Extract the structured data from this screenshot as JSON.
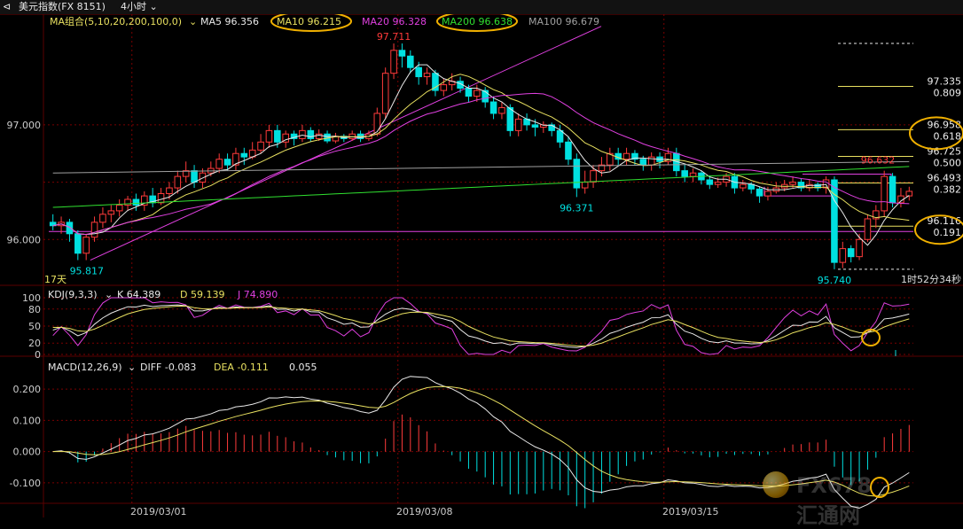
{
  "header": {
    "back_icon": "back-icon",
    "title": "美元指数(FX 8151)",
    "period": "4小时"
  },
  "ma_legend": [
    {
      "text": "MA组合(5,10,20,200,100,0)",
      "color": "#e8e060"
    },
    {
      "text": "MA5 96.356",
      "color": "#e8e8e8"
    },
    {
      "text": "MA10 96.215",
      "color": "#e8e060"
    },
    {
      "text": "MA20 96.328",
      "color": "#e040e0"
    },
    {
      "text": "MA200 96.638",
      "color": "#30e030"
    },
    {
      "text": "MA100 96.679",
      "color": "#a0a0a0"
    }
  ],
  "kdj_legend": [
    {
      "text": "KDJ(9,3,3)",
      "color": "#e8e8e8"
    },
    {
      "text": "K 64.389",
      "color": "#e8e8e8"
    },
    {
      "text": "D 59.139",
      "color": "#e8e060"
    },
    {
      "text": "J 74.890",
      "color": "#e040e0"
    }
  ],
  "macd_legend": [
    {
      "text": "MACD(12,26,9)",
      "color": "#e8e8e8"
    },
    {
      "text": "DIFF -0.083",
      "color": "#e8e8e8"
    },
    {
      "text": "DEA -0.111",
      "color": "#e8e060"
    },
    {
      "text": "0.055",
      "color": "#e8e8e8"
    }
  ],
  "price_axis": [
    "97.000",
    "96.000"
  ],
  "kdj_axis": [
    "100",
    "80",
    "50",
    "20",
    "0"
  ],
  "macd_axis": [
    "0.200",
    "0.100",
    "0.000",
    "-0.100"
  ],
  "date_labels": [
    "2019/03/01",
    "2019/03/08",
    "2019/03/15"
  ],
  "annotations": {
    "high": "97.711",
    "low1": "95.817",
    "mid_low": "96.371",
    "low2": "95.740",
    "fib_top": "96.632",
    "interval": "17天",
    "countdown": "1时52分34秒"
  },
  "fib_levels": [
    {
      "price": "97.335",
      "ratio": "0.809"
    },
    {
      "price": "96.958",
      "ratio": "0.618"
    },
    {
      "price": "96.725",
      "ratio": "0.500"
    },
    {
      "price": "96.493",
      "ratio": "0.382"
    },
    {
      "price": "96.116",
      "ratio": "0.191"
    }
  ],
  "watermark": "FX678汇通网",
  "colors": {
    "up": "#ff3b3b",
    "down": "#00e0e0",
    "ma5": "#e8e8e8",
    "ma10": "#e8e060",
    "ma20": "#e040e0",
    "ma200": "#30e030",
    "ma100": "#a0a0a0",
    "grid": "#7a0000",
    "highlight": "#f0b000"
  },
  "chart_data": {
    "type": "candlestick",
    "candles": [
      [
        96.15,
        96.12,
        96.22,
        96.08
      ],
      [
        96.12,
        96.15,
        96.2,
        96.05
      ],
      [
        96.15,
        96.05,
        96.18,
        95.98
      ],
      [
        96.05,
        95.88,
        96.08,
        95.82
      ],
      [
        95.88,
        96.02,
        96.05,
        95.82
      ],
      [
        96.02,
        96.15,
        96.2,
        95.98
      ],
      [
        96.15,
        96.22,
        96.28,
        96.1
      ],
      [
        96.22,
        96.25,
        96.3,
        96.15
      ],
      [
        96.25,
        96.3,
        96.35,
        96.2
      ],
      [
        96.3,
        96.35,
        96.38,
        96.25
      ],
      [
        96.35,
        96.3,
        96.4,
        96.25
      ],
      [
        96.3,
        96.38,
        96.42,
        96.25
      ],
      [
        96.38,
        96.32,
        96.45,
        96.28
      ],
      [
        96.32,
        96.4,
        96.45,
        96.3
      ],
      [
        96.4,
        96.45,
        96.5,
        96.35
      ],
      [
        96.45,
        96.55,
        96.6,
        96.4
      ],
      [
        96.55,
        96.6,
        96.68,
        96.5
      ],
      [
        96.6,
        96.5,
        96.65,
        96.45
      ],
      [
        96.5,
        96.58,
        96.62,
        96.45
      ],
      [
        96.58,
        96.62,
        96.68,
        96.55
      ],
      [
        96.62,
        96.7,
        96.75,
        96.58
      ],
      [
        96.7,
        96.65,
        96.75,
        96.6
      ],
      [
        96.65,
        96.75,
        96.8,
        96.6
      ],
      [
        96.75,
        96.72,
        96.8,
        96.65
      ],
      [
        96.72,
        96.78,
        96.85,
        96.7
      ],
      [
        96.78,
        96.85,
        96.92,
        96.75
      ],
      [
        96.85,
        96.95,
        97,
        96.8
      ],
      [
        96.95,
        96.85,
        97,
        96.8
      ],
      [
        96.85,
        96.92,
        96.95,
        96.8
      ],
      [
        96.92,
        96.88,
        96.95,
        96.82
      ],
      [
        96.88,
        96.95,
        97,
        96.85
      ],
      [
        96.95,
        96.88,
        96.98,
        96.85
      ],
      [
        96.88,
        96.92,
        96.96,
        96.86
      ],
      [
        96.92,
        96.86,
        96.95,
        96.84
      ],
      [
        96.86,
        96.9,
        96.93,
        96.84
      ],
      [
        96.9,
        96.88,
        96.92,
        96.85
      ],
      [
        96.88,
        96.92,
        96.95,
        96.86
      ],
      [
        96.92,
        96.88,
        96.95,
        96.85
      ],
      [
        96.88,
        96.92,
        96.95,
        96.86
      ],
      [
        96.92,
        97.1,
        97.15,
        96.9
      ],
      [
        97.1,
        97.45,
        97.5,
        97.05
      ],
      [
        97.45,
        97.65,
        97.71,
        97.4
      ],
      [
        97.65,
        97.6,
        97.71,
        97.5
      ],
      [
        97.6,
        97.5,
        97.65,
        97.45
      ],
      [
        97.5,
        97.42,
        97.55,
        97.35
      ],
      [
        97.42,
        97.45,
        97.5,
        97.35
      ],
      [
        97.45,
        97.3,
        97.48,
        97.25
      ],
      [
        97.3,
        97.35,
        97.4,
        97.25
      ],
      [
        97.35,
        97.38,
        97.45,
        97.3
      ],
      [
        97.38,
        97.32,
        97.42,
        97.28
      ],
      [
        97.32,
        97.25,
        97.35,
        97.2
      ],
      [
        97.25,
        97.3,
        97.35,
        97.2
      ],
      [
        97.3,
        97.2,
        97.33,
        97.15
      ],
      [
        97.2,
        97.1,
        97.25,
        97.05
      ],
      [
        97.1,
        97.15,
        97.2,
        97.05
      ],
      [
        97.15,
        96.95,
        97.18,
        96.9
      ],
      [
        96.95,
        97.05,
        97.1,
        96.9
      ],
      [
        97.05,
        97,
        97.1,
        96.95
      ],
      [
        97,
        96.98,
        97.05,
        96.9
      ],
      [
        96.98,
        97,
        97.03,
        96.93
      ],
      [
        97,
        96.95,
        97.02,
        96.9
      ],
      [
        96.95,
        96.85,
        97,
        96.8
      ],
      [
        96.85,
        96.7,
        96.9,
        96.65
      ],
      [
        96.7,
        96.45,
        96.75,
        96.37
      ],
      [
        96.45,
        96.5,
        96.6,
        96.4
      ],
      [
        96.5,
        96.6,
        96.65,
        96.45
      ],
      [
        96.6,
        96.65,
        96.72,
        96.55
      ],
      [
        96.65,
        96.75,
        96.8,
        96.6
      ],
      [
        96.75,
        96.7,
        96.8,
        96.65
      ],
      [
        96.7,
        96.75,
        96.8,
        96.65
      ],
      [
        96.75,
        96.7,
        96.78,
        96.65
      ],
      [
        96.7,
        96.65,
        96.73,
        96.6
      ],
      [
        96.65,
        96.72,
        96.76,
        96.6
      ],
      [
        96.72,
        96.68,
        96.76,
        96.62
      ],
      [
        96.68,
        96.75,
        96.8,
        96.65
      ],
      [
        96.75,
        96.6,
        96.8,
        96.55
      ],
      [
        96.6,
        96.55,
        96.65,
        96.5
      ],
      [
        96.55,
        96.58,
        96.62,
        96.5
      ],
      [
        96.58,
        96.52,
        96.6,
        96.48
      ],
      [
        96.52,
        96.48,
        96.56,
        96.44
      ],
      [
        96.48,
        96.5,
        96.54,
        96.45
      ],
      [
        96.5,
        96.55,
        96.58,
        96.46
      ],
      [
        96.55,
        96.45,
        96.58,
        96.4
      ],
      [
        96.45,
        96.48,
        96.52,
        96.42
      ],
      [
        96.48,
        96.44,
        96.5,
        96.4
      ],
      [
        96.44,
        96.38,
        96.46,
        96.32
      ],
      [
        96.38,
        96.42,
        96.46,
        96.34
      ],
      [
        96.42,
        96.45,
        96.5,
        96.4
      ],
      [
        96.45,
        96.48,
        96.52,
        96.42
      ],
      [
        96.48,
        96.5,
        96.55,
        96.45
      ],
      [
        96.5,
        96.45,
        96.53,
        96.42
      ],
      [
        96.45,
        96.48,
        96.52,
        96.42
      ],
      [
        96.48,
        96.45,
        96.5,
        96.42
      ],
      [
        96.45,
        96.52,
        96.55,
        96.4
      ],
      [
        96.52,
        95.8,
        96.55,
        95.74
      ],
      [
        95.8,
        95.92,
        95.98,
        95.75
      ],
      [
        95.92,
        95.85,
        95.95,
        95.8
      ],
      [
        95.85,
        96,
        96.05,
        95.82
      ],
      [
        96,
        96.18,
        96.22,
        95.98
      ],
      [
        96.18,
        96.25,
        96.3,
        96.1
      ],
      [
        96.25,
        96.55,
        96.6,
        96.2
      ],
      [
        96.55,
        96.32,
        96.58,
        96.28
      ],
      [
        96.32,
        96.38,
        96.45,
        96.28
      ],
      [
        96.38,
        96.42,
        96.46,
        96.34
      ]
    ],
    "ma_lines": [
      "MA5",
      "MA10",
      "MA20",
      "MA200",
      "MA100"
    ],
    "kdj": {
      "K": 64.389,
      "D": 59.139,
      "J": 74.89
    },
    "macd": {
      "DIFF": -0.083,
      "DEA": -0.111,
      "MACD": 0.055
    },
    "y_range": [
      95.6,
      97.95
    ]
  }
}
